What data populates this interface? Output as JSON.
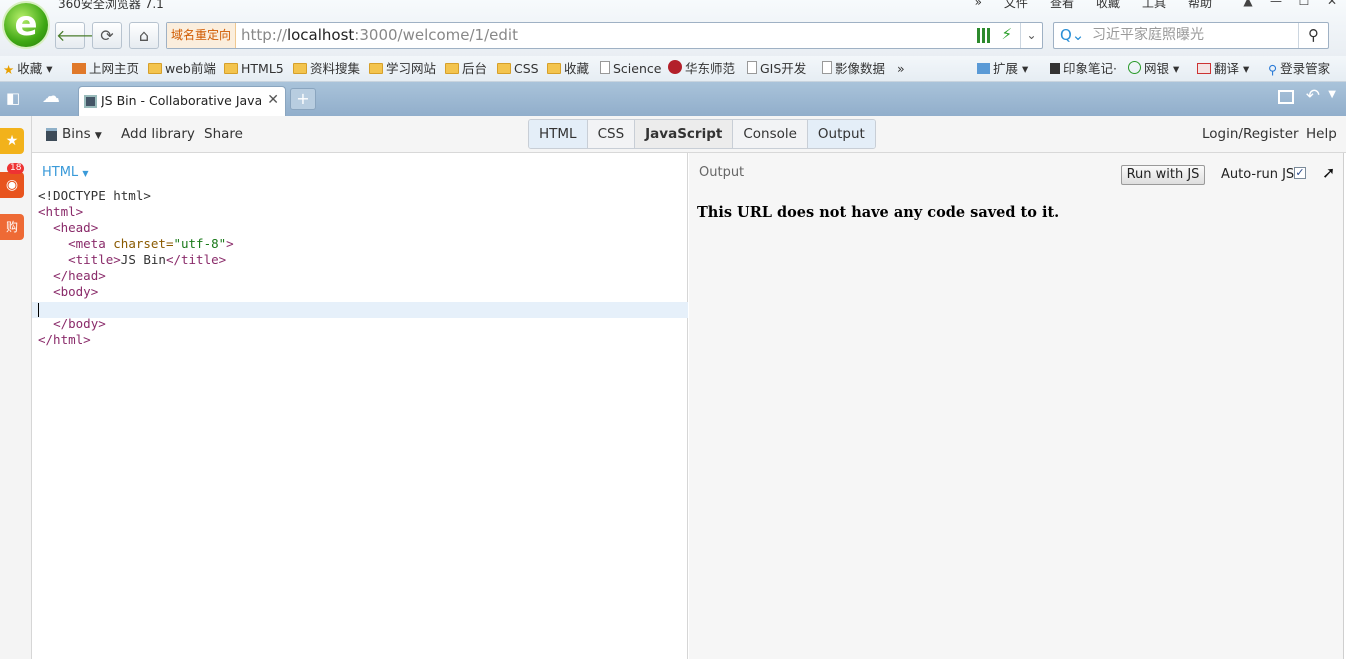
{
  "browser": {
    "app_title": "360安全浏览器 7.1",
    "menu": [
      "文件",
      "查看",
      "收藏",
      "工具",
      "帮助"
    ],
    "redirect_label": "域名重定向",
    "url_scheme": "http://",
    "url_host": "localhost",
    "url_rest": ":3000/welcome/1/edit",
    "search_placeholder": "习近平家庭照曝光",
    "bookmarks": [
      {
        "label": "收藏"
      },
      {
        "label": "上网主页"
      },
      {
        "label": "web前端"
      },
      {
        "label": "HTML5"
      },
      {
        "label": "资料搜集"
      },
      {
        "label": "学习网站"
      },
      {
        "label": "后台"
      },
      {
        "label": "CSS"
      },
      {
        "label": "收藏"
      },
      {
        "label": "Science"
      },
      {
        "label": "华东师范"
      },
      {
        "label": "GIS开发"
      },
      {
        "label": "影像数据"
      }
    ],
    "more": "»",
    "right_tools": [
      "扩展",
      "印象笔记·",
      "网银",
      "翻译",
      "登录管家"
    ],
    "tab_title": "JS Bin - Collaborative JavaScript Debugging",
    "sidebar_badge": "18",
    "sidebar_shop": "购"
  },
  "jsbin": {
    "bins": "Bins",
    "add_library": "Add library",
    "share": "Share",
    "panels": [
      "HTML",
      "CSS",
      "JavaScript",
      "Console",
      "Output"
    ],
    "login": "Login/Register",
    "help": "Help",
    "editor_label": "HTML",
    "output_label": "Output",
    "run_button": "Run with JS",
    "autorun_label": "Auto-run JS",
    "autorun_checked": true,
    "output_message": "This URL does not have any code saved to it."
  },
  "code": {
    "line1": "<!DOCTYPE html>",
    "line2": "<html>",
    "line3": "<head>",
    "line4_open": "<meta ",
    "line4_attr": "charset=",
    "line4_str": "\"utf-8\"",
    "line4_close": ">",
    "line5_open": "<title>",
    "line5_text": "JS Bin",
    "line5_close": "</title>",
    "line6": "</head>",
    "line7": "<body>",
    "line9": "</body>",
    "line10": "</html>"
  }
}
